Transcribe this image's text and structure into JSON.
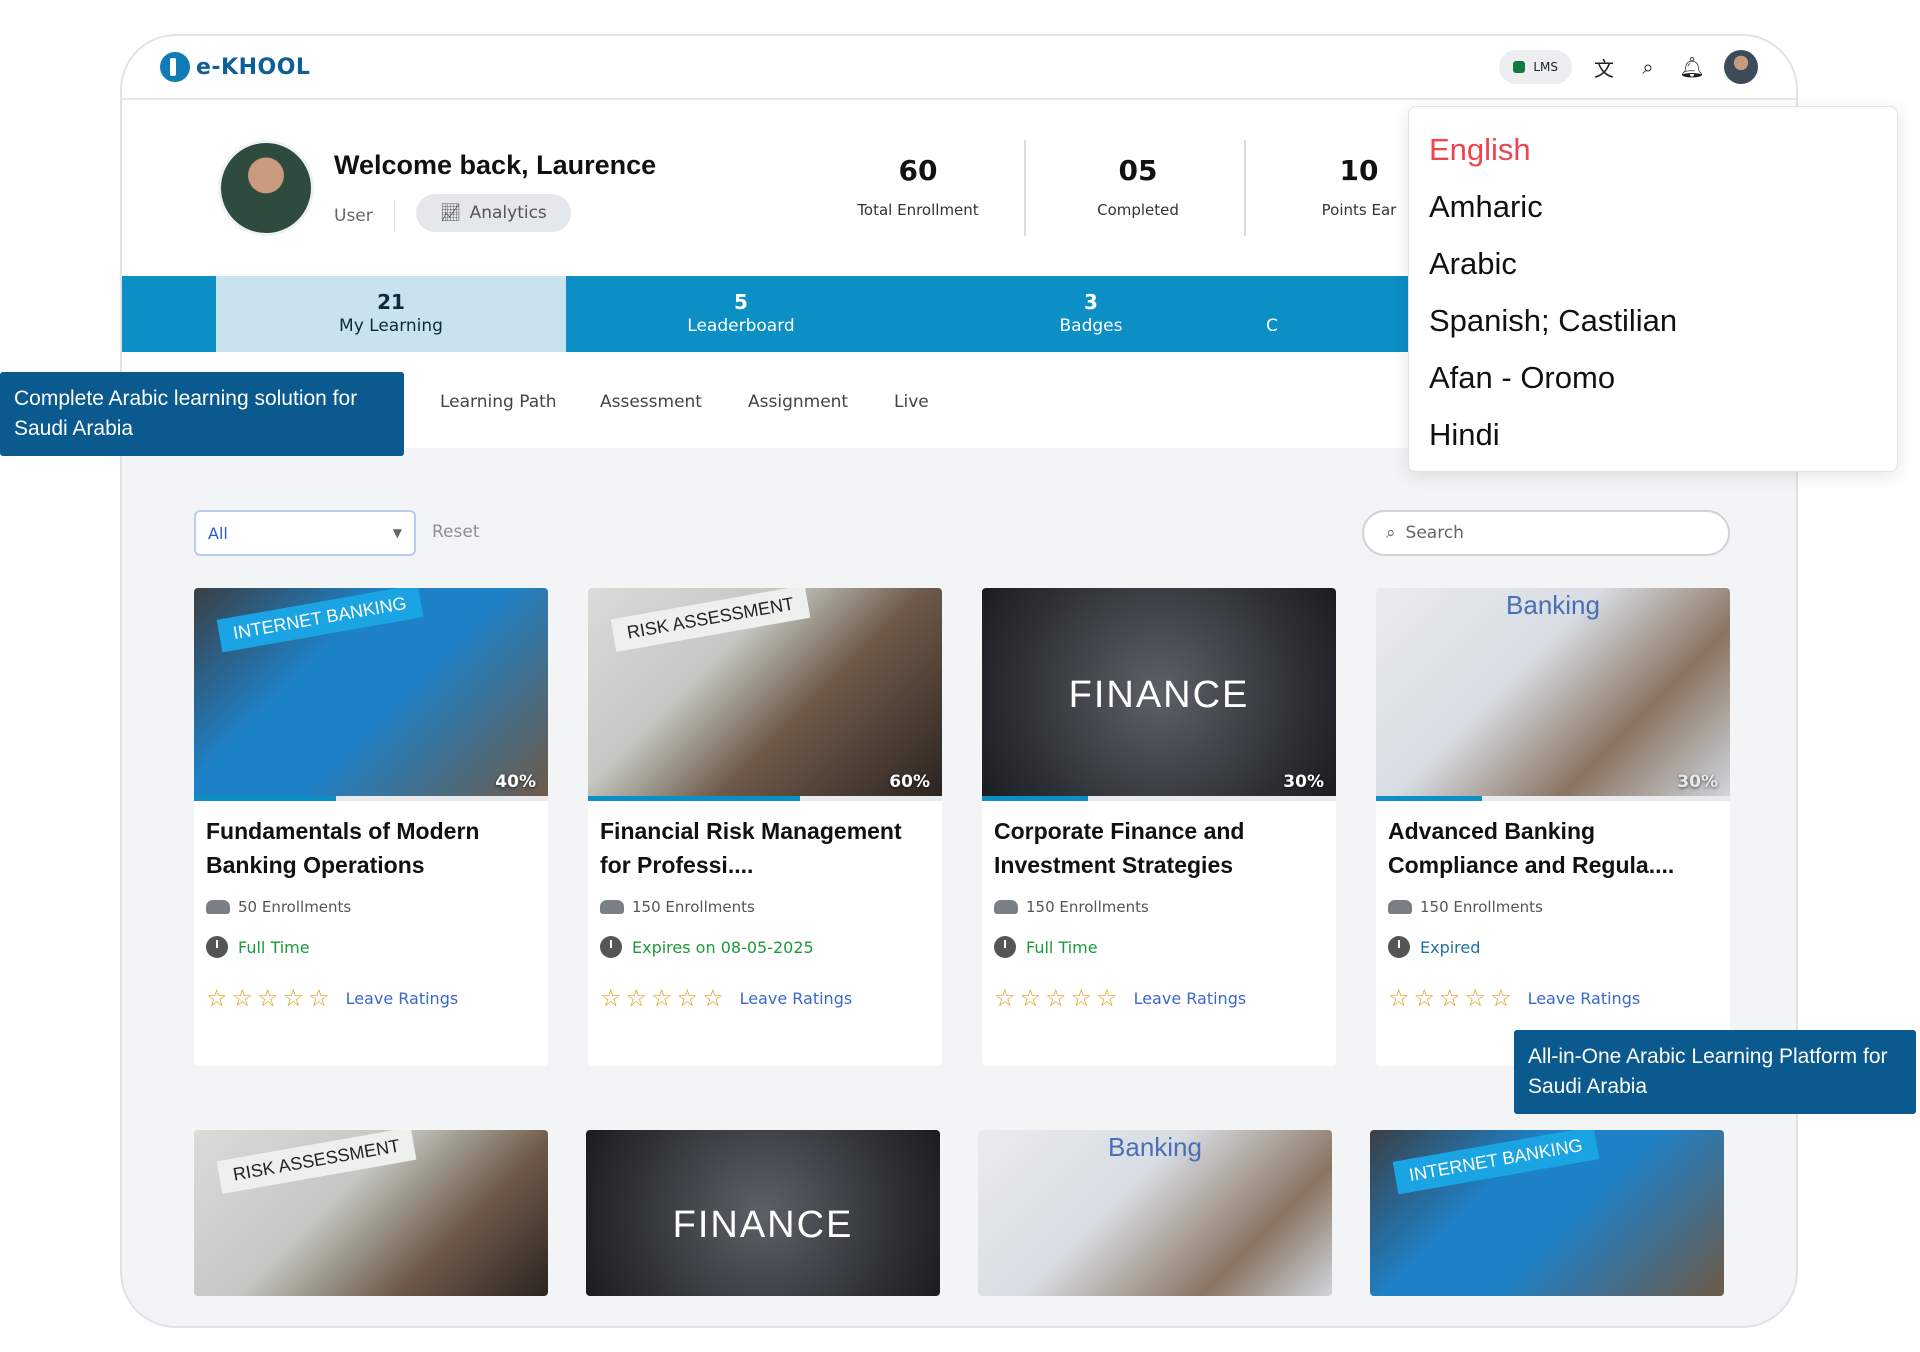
{
  "brand": {
    "name": "e-KHOOL"
  },
  "topbar": {
    "lms_label": "LMS",
    "icons": [
      "translate-icon",
      "search-icon",
      "bell-icon"
    ]
  },
  "profile": {
    "greeting": "Welcome back, Laurence",
    "role": "User",
    "analytics_label": "Analytics"
  },
  "stats": [
    {
      "value": "60",
      "label": "Total Enrollment"
    },
    {
      "value": "05",
      "label": "Completed"
    },
    {
      "value": "10",
      "label": "Points Ear"
    }
  ],
  "tabs": [
    {
      "count": "21",
      "label": "My Learning"
    },
    {
      "count": "5",
      "label": "Leaderboard"
    },
    {
      "count": "3",
      "label": "Badges"
    },
    {
      "count": "",
      "label": "C"
    }
  ],
  "subtabs": [
    "Learning Path",
    "Assessment",
    "Assignment",
    "Live"
  ],
  "filters": {
    "select_value": "All",
    "reset_label": "Reset",
    "search_placeholder": "Search"
  },
  "courses": [
    {
      "title": "Fundamentals of Modern Banking Operations",
      "thumb": "INTERNET BANKING",
      "progress": 40,
      "progress_label": "40%",
      "enrollments": "50 Enrollments",
      "status": "Full Time",
      "status_color": "#1b9a3a",
      "rating_label": "Leave Ratings"
    },
    {
      "title": "Financial Risk Management for Professi....",
      "thumb": "RISK ASSESSMENT",
      "progress": 60,
      "progress_label": "60%",
      "enrollments": "150 Enrollments",
      "status": "Expires on 08-05-2025",
      "status_color": "#1b9a3a",
      "rating_label": "Leave Ratings"
    },
    {
      "title": "Corporate Finance and Investment Strategies",
      "thumb": "FINANCE",
      "progress": 30,
      "progress_label": "30%",
      "enrollments": "150 Enrollments",
      "status": "Full Time",
      "status_color": "#1b9a3a",
      "rating_label": "Leave Ratings"
    },
    {
      "title": "Advanced Banking Compliance and Regula....",
      "thumb": "Banking",
      "progress": 30,
      "progress_label": "30%",
      "enrollments": "150 Enrollments",
      "status": "Expired",
      "status_color": "#1f6fa3",
      "rating_label": "Leave Ratings"
    }
  ],
  "courses_row2": [
    {
      "thumb": "RISK ASSESSMENT"
    },
    {
      "thumb": "FINANCE"
    },
    {
      "thumb": "Banking"
    },
    {
      "thumb": "INTERNET BANKING"
    }
  ],
  "languages": [
    "English",
    "Amharic",
    "Arabic",
    "Spanish; Castilian",
    "Afan - Oromo",
    "Hindi"
  ],
  "selected_language": "English",
  "callouts": {
    "left": "Complete Arabic learning solution for Saudi Arabia",
    "right": "All-in-One Arabic Learning Platform for Saudi Arabia"
  }
}
